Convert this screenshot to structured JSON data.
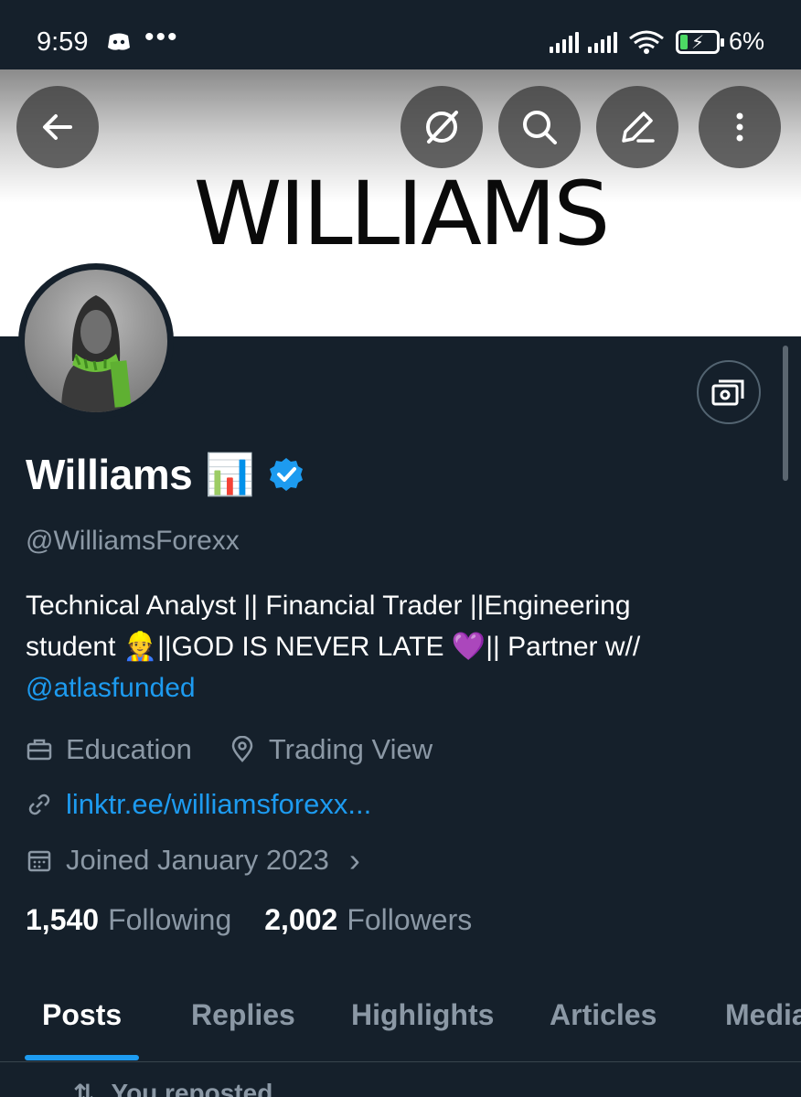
{
  "status_bar": {
    "time": "9:59",
    "dots": "•••",
    "battery_percent": "6%",
    "battery_level": 0.06
  },
  "banner": {
    "text": "WILLIAMS"
  },
  "header_buttons": {
    "back_icon": "arrow-left-icon",
    "grok_icon": "grok-icon",
    "search_icon": "search-icon",
    "edit_icon": "edit-icon",
    "more_icon": "more-vertical-icon"
  },
  "profile": {
    "name": "Williams",
    "name_emoji": "📊",
    "handle": "@WilliamsForexx",
    "bio_line1": "Technical Analyst || Financial Trader ||Engineering",
    "bio_line2": "student 👷||GOD IS NEVER LATE 💜|| Partner w//",
    "bio_mention": "@atlasfunded",
    "category": "Education",
    "location": "Trading View",
    "website": "linktr.ee/williamsforexx...",
    "joined": "Joined January 2023",
    "joined_chevron": "›",
    "following_count": "1,540",
    "following_label": "Following",
    "followers_count": "2,002",
    "followers_label": "Followers"
  },
  "tabs": [
    {
      "label": "Posts",
      "active": true
    },
    {
      "label": "Replies",
      "active": false
    },
    {
      "label": "Highlights",
      "active": false
    },
    {
      "label": "Articles",
      "active": false
    },
    {
      "label": "Media",
      "active": false
    }
  ],
  "feed": {
    "repost_label": "You reposted"
  },
  "colors": {
    "background": "#15202b",
    "accent": "#1d9bf0",
    "secondary_text": "#8b98a5",
    "verified": "#1d9bf0"
  }
}
